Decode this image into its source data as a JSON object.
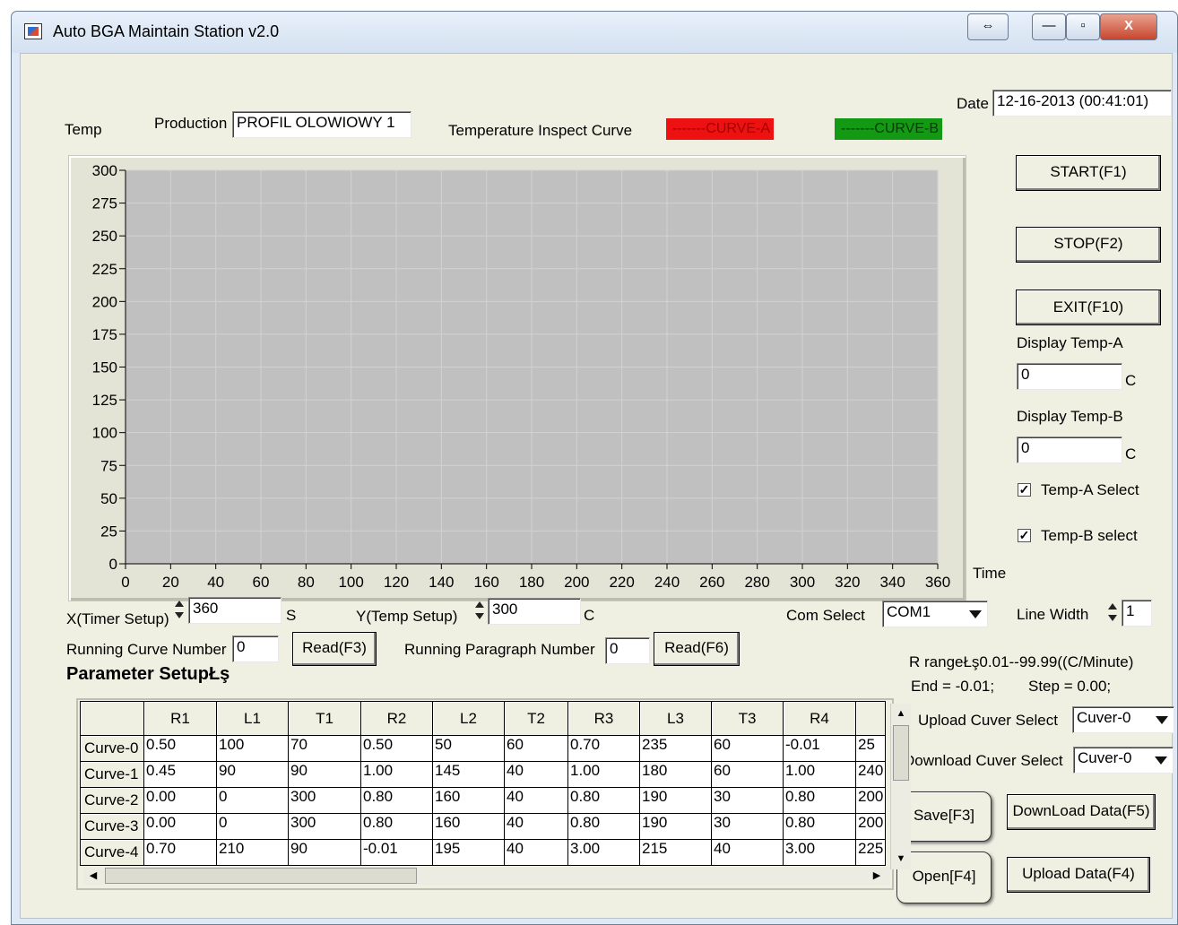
{
  "window": {
    "title": "Auto BGA Maintain Station v2.0"
  },
  "titlebar_buttons": {
    "restore_swap": "⇔",
    "minimize": "—",
    "maximize": "▫",
    "close": "X"
  },
  "header": {
    "temp_label": "Temp",
    "production_label": "Production",
    "production_value": "PROFIL OLOWIOWY 1",
    "curve_title": "Temperature Inspect Curve",
    "curve_a": "-------CURVE-A",
    "curve_b": "-------CURVE-B",
    "curve_a_color": "#ee1111",
    "curve_b_color": "#139913",
    "date_label": "Date",
    "date_value": "12-16-2013 (00:41:01)"
  },
  "chart_data": {
    "type": "line",
    "x": [],
    "series": [],
    "xlim": [
      0,
      360
    ],
    "ylim": [
      0,
      300
    ],
    "xticks": [
      0,
      20,
      40,
      60,
      80,
      100,
      120,
      140,
      160,
      180,
      200,
      220,
      240,
      260,
      280,
      300,
      320,
      340,
      360
    ],
    "yticks": [
      0,
      25,
      50,
      75,
      100,
      125,
      150,
      175,
      200,
      225,
      250,
      275,
      300
    ],
    "xlabel": "Time",
    "ylabel": "Temp",
    "grid": true,
    "plot_bg": "#c0c0c0"
  },
  "controls": {
    "start": "START(F1)",
    "stop": "STOP(F2)",
    "exit": "EXIT(F10)",
    "display_temp_a_label": "Display Temp-A",
    "display_temp_a_value": "0",
    "display_temp_a_unit": "C",
    "display_temp_b_label": "Display Temp-B",
    "display_temp_b_value": "0",
    "display_temp_b_unit": "C",
    "temp_a_select": "Temp-A  Select",
    "temp_b_select": "Temp-B select",
    "temp_a_checked": true,
    "temp_b_checked": true,
    "check_mark": "✓"
  },
  "setup": {
    "x_timer_label": "X(Timer Setup)",
    "x_timer_value": "360",
    "x_timer_unit": "S",
    "y_temp_label": "Y(Temp Setup)",
    "y_temp_value": "300",
    "y_temp_unit": "C",
    "com_label": "Com  Select",
    "com_value": "COM1",
    "line_width_label": "Line  Width",
    "line_width_value": "1",
    "running_curve_label": "Running Curve Number",
    "running_curve_value": "0",
    "read_f3": "Read(F3)",
    "running_paragraph_label": "Running Paragraph Number",
    "running_paragraph_value": "0",
    "read_f6": "Read(F6)",
    "r_range": "R rangeŁş0.01--99.99((C/Minute)",
    "end_label": "End = -0.01;",
    "step_label": "Step = 0.00;",
    "upload_select_label": "Upload Cuver Select",
    "upload_select_value": "Cuver-0",
    "download_select_label": "Download Cuver Select",
    "download_select_value": "Cuver-0",
    "save": "Save[F3]",
    "open": "Open[F4]",
    "download_data": "DownLoad Data(F5)",
    "upload_data": "Upload Data(F4)"
  },
  "params": {
    "title": "Parameter SetupŁş",
    "columns": [
      "",
      "R1",
      "L1",
      "T1",
      "R2",
      "L2",
      "T2",
      "R3",
      "L3",
      "T3",
      "R4",
      ""
    ],
    "rows": [
      [
        "Curve-0",
        "0.50",
        "100",
        "70",
        "0.50",
        "50",
        "60",
        "0.70",
        "235",
        "60",
        "-0.01",
        "25"
      ],
      [
        "Curve-1",
        "0.45",
        "90",
        "90",
        "1.00",
        "145",
        "40",
        "1.00",
        "180",
        "60",
        "1.00",
        "240"
      ],
      [
        "Curve-2",
        "0.00",
        "0",
        "300",
        "0.80",
        "160",
        "40",
        "0.80",
        "190",
        "30",
        "0.80",
        "200"
      ],
      [
        "Curve-3",
        "0.00",
        "0",
        "300",
        "0.80",
        "160",
        "40",
        "0.80",
        "190",
        "30",
        "0.80",
        "200"
      ],
      [
        "Curve-4",
        "0.70",
        "210",
        "90",
        "-0.01",
        "195",
        "40",
        "3.00",
        "215",
        "40",
        "3.00",
        "225"
      ]
    ]
  }
}
